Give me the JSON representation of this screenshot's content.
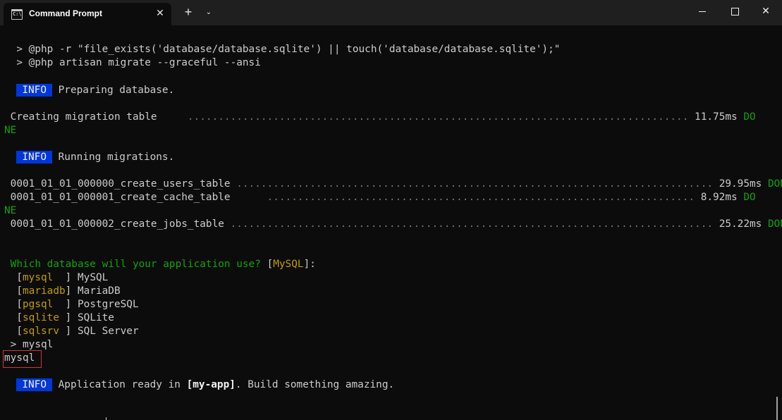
{
  "window": {
    "tab_title": "Command Prompt",
    "tab_icon": "cmd-icon",
    "tab_icon_glyph": "C:\\",
    "close_tab_glyph": "✕",
    "new_tab_glyph": "+",
    "dropdown_glyph": "⌄",
    "close_window_glyph": "✕"
  },
  "terminal": {
    "cmd1": "  > @php -r \"file_exists('database/database.sqlite') || touch('database/database.sqlite');\"",
    "cmd2": "  > @php artisan migrate --graceful --ansi",
    "info_tag": "INFO",
    "info1_text": " Preparing database.",
    "migration_table": {
      "label": " Creating migration table     ",
      "dots": "..................................................................................",
      "time": " 11.75ms ",
      "status_part1": "DO",
      "status_part2": "NE"
    },
    "info2_text": " Running migrations.",
    "migrations": [
      {
        "name": " 0001_01_01_000000_create_users_table ",
        "dots": "..............................................................................",
        "time": " 29.95ms ",
        "status": "DONE"
      },
      {
        "name": " 0001_01_01_000001_create_cache_table ",
        "dots": "     ......................................................................",
        "time": " 8.92ms ",
        "status_part1": "DO",
        "status_part2": "NE"
      },
      {
        "name": " 0001_01_01_000002_create_jobs_table ",
        "dots": "...............................................................................",
        "time": " 25.22ms ",
        "status": "DONE"
      }
    ],
    "question": " Which database will your application use? ",
    "question_bracket_open": "[",
    "question_default": "MySQL",
    "question_bracket_close": "]:",
    "options": [
      {
        "key": "mysql  ",
        "label": " MySQL"
      },
      {
        "key": "mariadb",
        "label": " MariaDB"
      },
      {
        "key": "pgsql  ",
        "label": " PostgreSQL"
      },
      {
        "key": "sqlite ",
        "label": " SQLite"
      },
      {
        "key": "sqlsrv ",
        "label": " SQL Server"
      }
    ],
    "answer_prompt": " > mysql",
    "answer_echo": "mysql",
    "final_text_pre": " Application ready in ",
    "final_app": "[my-app]",
    "final_text_post": ". Build something amazing."
  },
  "colors": {
    "background": "#0c0c0c",
    "text": "#cccccc",
    "info_badge": "#0037da",
    "done": "#13a10e",
    "highlight_box": "#d13438",
    "option_key": "#c19c00"
  }
}
